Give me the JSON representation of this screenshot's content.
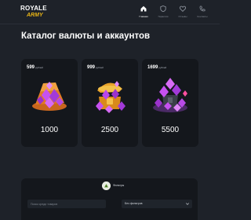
{
  "header": {
    "logo_top": "ROYALE",
    "logo_bottom": "ARMY",
    "nav": [
      {
        "label": "Главная",
        "icon": "home-icon",
        "active": true
      },
      {
        "label": "Гарантии",
        "icon": "shield-icon",
        "active": false
      },
      {
        "label": "Отзывы",
        "icon": "heart-icon",
        "active": false
      },
      {
        "label": "Контакты",
        "icon": "contacts-icon",
        "active": false
      }
    ]
  },
  "main": {
    "title": "Каталог валюты и аккаунтов",
    "cards": [
      {
        "price": "599",
        "currency": "рублей",
        "amount": "1000",
        "art_icon": "purple-gems-orange-box-icon"
      },
      {
        "price": "999",
        "currency": "рублей",
        "amount": "2500",
        "art_icon": "gold-chest-purple-gems-icon"
      },
      {
        "price": "1699",
        "currency": "рублей",
        "amount": "5500",
        "art_icon": "purple-gem-pile-icon"
      }
    ]
  },
  "filters": {
    "label": "Фильтры",
    "icon": "filter-emblem-icon",
    "search_placeholder": "Поиск среди товаров",
    "select_value": "Без фильтров"
  },
  "colors": {
    "background": "#1e2229",
    "card": "#14171c",
    "accent": "#e8b416",
    "gem_purple": "#b042e8"
  }
}
